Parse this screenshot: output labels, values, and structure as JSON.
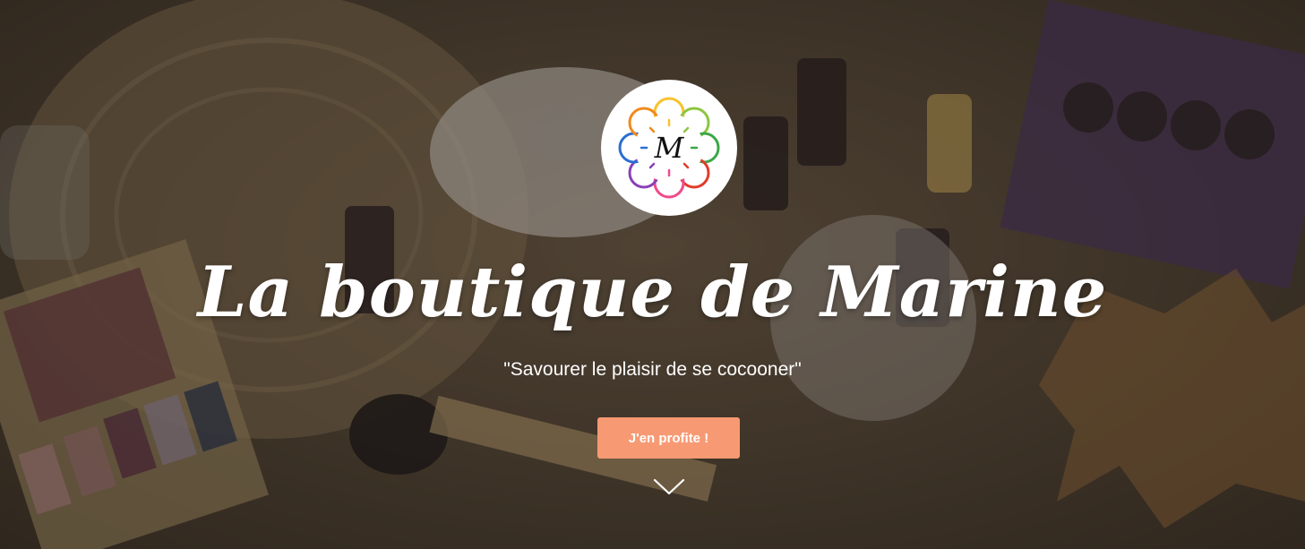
{
  "hero": {
    "logo_letter": "M",
    "title": "La boutique de Marine",
    "tagline": "\"Savourer le plaisir de se cocooner\"",
    "cta_label": "J'en profite !",
    "scroll_icon": "chevron-down-icon"
  },
  "colors": {
    "accent": "#f79a73",
    "text": "#ffffff",
    "logo_bg": "#ffffff"
  }
}
